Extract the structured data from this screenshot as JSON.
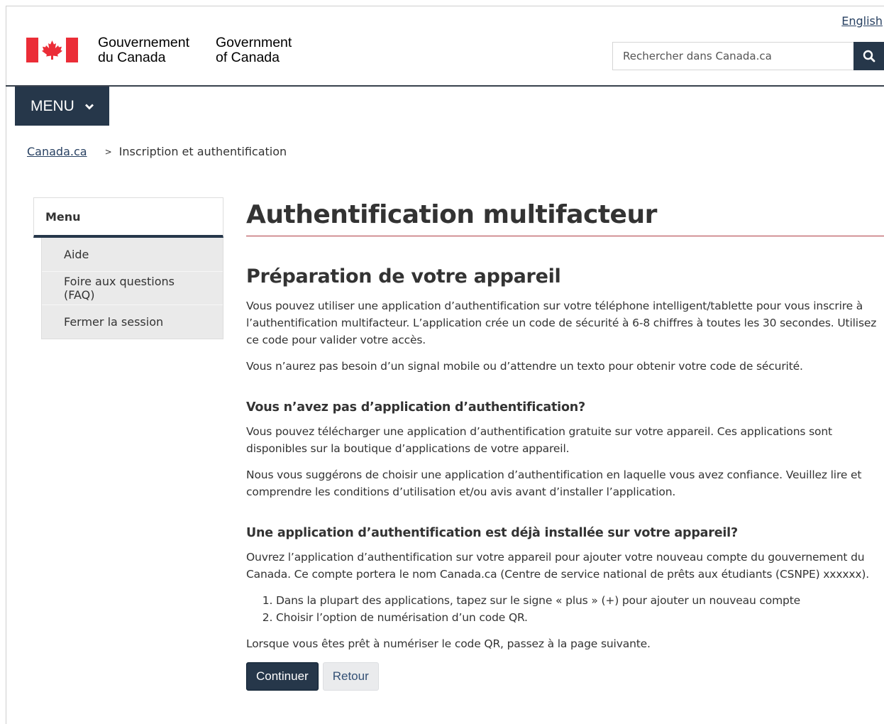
{
  "header": {
    "language_toggle": "English",
    "signature_fr_line1": "Gouvernement",
    "signature_fr_line2": "du Canada",
    "signature_en_line1": "Government",
    "signature_en_line2": "of Canada",
    "search_placeholder": "Rechercher dans Canada.ca",
    "search_icon": "search-icon",
    "flag_color": "#eb2d37"
  },
  "menu_button": {
    "label": "MENU",
    "icon": "chevron-down-icon"
  },
  "breadcrumb": {
    "home": "Canada.ca",
    "separator": ">",
    "current": "Inscription et authentification"
  },
  "side_menu": {
    "title": "Menu",
    "items": [
      {
        "label": "Aide"
      },
      {
        "label": "Foire aux questions (FAQ)"
      },
      {
        "label": "Fermer la session"
      }
    ]
  },
  "main": {
    "title": "Authentification multifacteur",
    "subtitle": "Préparation de votre appareil",
    "intro_p1": "Vous pouvez utiliser une application d’authentification sur votre téléphone intelligent/tablette pour vous inscrire à l’authentification multifacteur. L’application crée un code de sécurité à 6-8 chiffres à toutes les 30 secondes. Utilisez ce code pour valider votre accès.",
    "intro_p2": "Vous n’aurez pas besoin d’un signal mobile ou d’attendre un texto pour obtenir votre code de sécurité.",
    "section1_title": "Vous n’avez pas d’application d’authentification?",
    "section1_p1": "Vous pouvez télécharger une application d’authentification gratuite sur votre appareil. Ces applications sont disponibles sur la boutique d’applications de votre appareil.",
    "section1_p2": "Nous vous suggérons de choisir une application d’authentification en laquelle vous avez confiance. Veuillez lire et comprendre les conditions d’utilisation et/ou avis avant d’installer l’application.",
    "section2_title": "Une application d’authentification est déjà installée sur votre appareil?",
    "section2_p1": "Ouvrez l’application d’authentification sur votre appareil pour ajouter votre nouveau compte du gouvernement du Canada. Ce compte portera le nom Canada.ca (Centre de service national de prêts aux étudiants (CSNPE) xxxxxx).",
    "steps": [
      "Dans la plupart des applications, tapez sur le signe « plus » (+) pour ajouter un nouveau compte",
      "Choisir l’option de numérisation d’un code QR."
    ],
    "closing": "Lorsque vous êtes prêt à numériser le code QR, passez à la page suivante."
  },
  "actions": {
    "continue_label": "Continuer",
    "back_label": "Retour"
  }
}
